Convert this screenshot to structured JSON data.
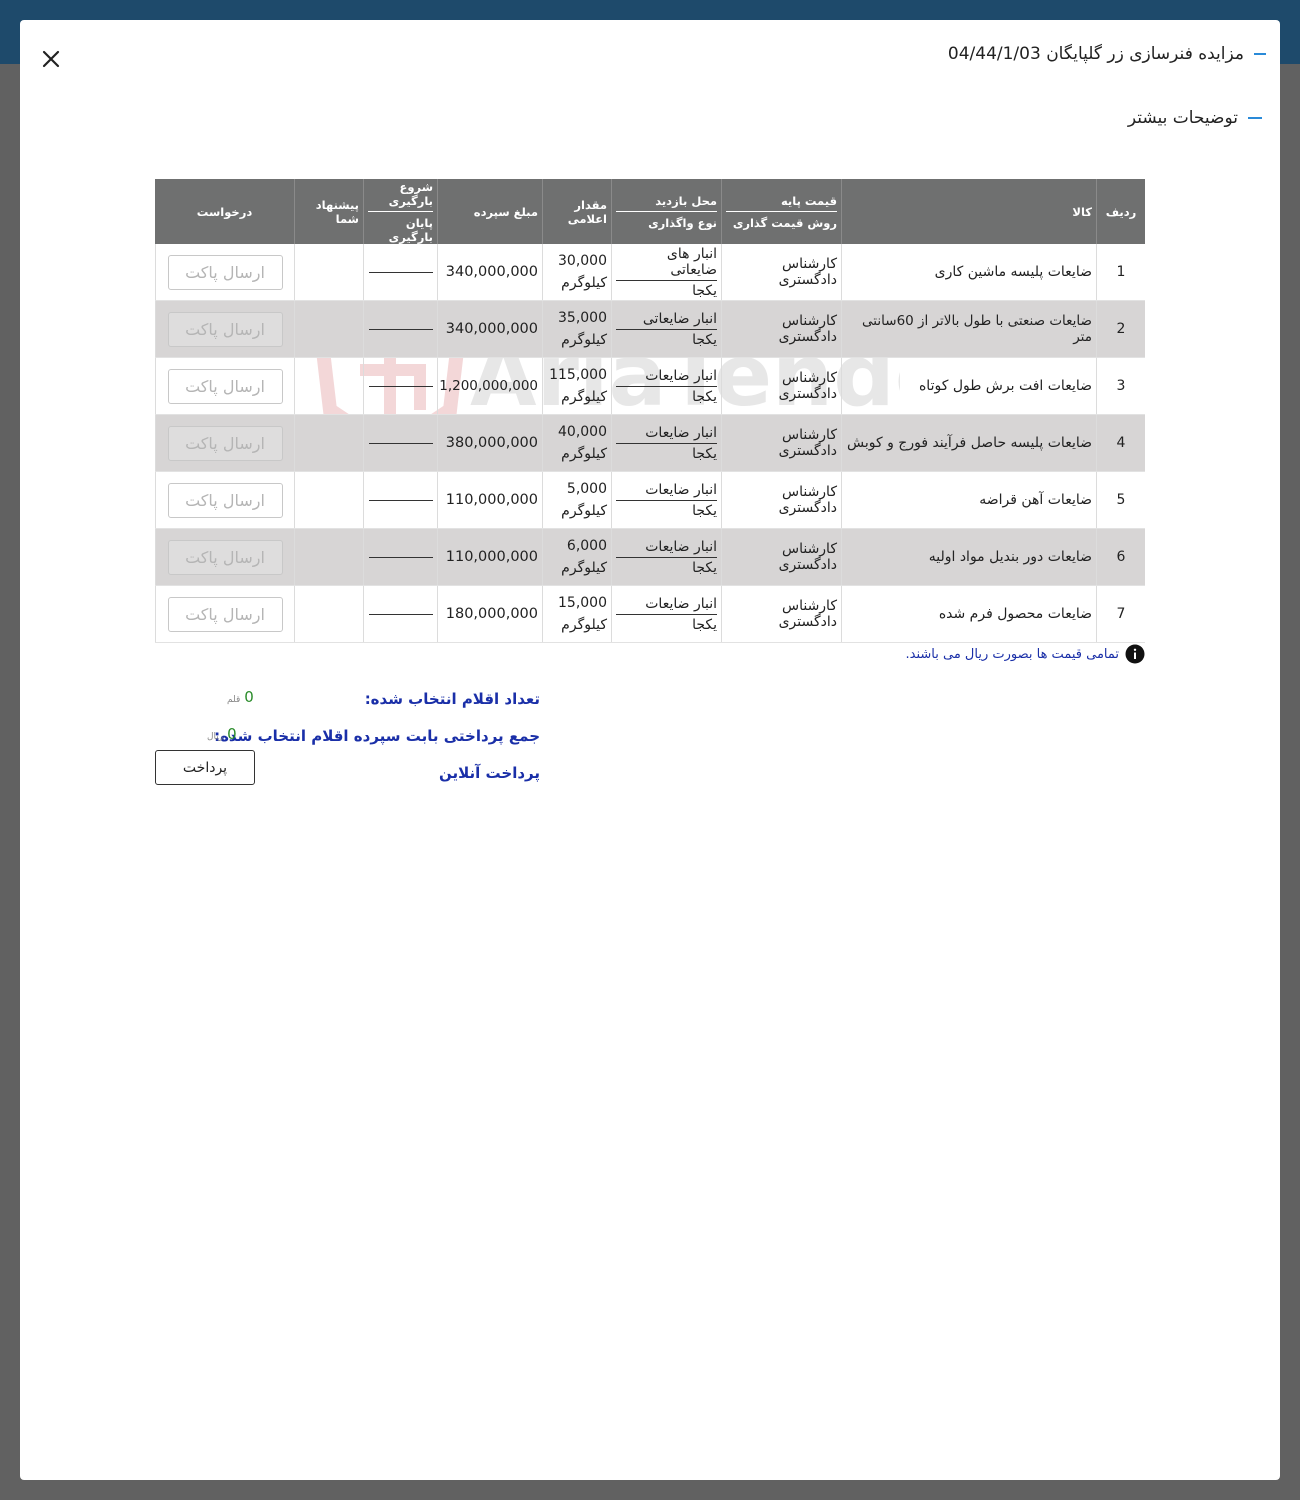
{
  "modal": {
    "title": "مزایده فنرسازی زر گلپایگان 04/44/1/03",
    "subtitle": "توضیحات بیشتر"
  },
  "watermark": "AriaTender.neT",
  "table": {
    "headers": {
      "row_no": "ردیف",
      "item": "کالا",
      "base_price": "قیمت پایه",
      "pricing_method": "روش قیمت گذاری",
      "visit_place": "محل بازدید",
      "assign_type": "نوع واگذاری",
      "quantity": "مقدار اعلامی",
      "deposit": "مبلغ سپرده",
      "load_start": "شروع بارگیری",
      "load_end": "پایان بارگیری",
      "your_offer": "پیشنهاد شما",
      "request": "درخواست"
    },
    "rows": [
      {
        "no": "1",
        "item": "ضایعات پلیسه ماشین کاری",
        "pricing": "کارشناس دادگستری",
        "place": "انبار های ضایعاتی",
        "assign": "یکجا",
        "qty": "30,000",
        "unit": "کیلوگرم",
        "deposit": "340,000,000",
        "action": "ارسال پاکت"
      },
      {
        "no": "2",
        "item": "ضایعات صنعتی با طول بالاتر از 60سانتی متر",
        "pricing": "کارشناس دادگستری",
        "place": "انبار ضایعاتی",
        "assign": "یکجا",
        "qty": "35,000",
        "unit": "کیلوگرم",
        "deposit": "340,000,000",
        "action": "ارسال پاکت"
      },
      {
        "no": "3",
        "item": "ضایعات افت برش طول کوتاه",
        "pricing": "کارشناس دادگستری",
        "place": "انبار ضایعات",
        "assign": "یکجا",
        "qty": "115,000",
        "unit": "کیلوگرم",
        "deposit": "1,200,000,000",
        "action": "ارسال پاکت"
      },
      {
        "no": "4",
        "item": "ضایعات پلیسه حاصل فرآیند فورج و کوبش",
        "pricing": "کارشناس دادگستری",
        "place": "انبار ضایعات",
        "assign": "یکجا",
        "qty": "40,000",
        "unit": "کیلوگرم",
        "deposit": "380,000,000",
        "action": "ارسال پاکت"
      },
      {
        "no": "5",
        "item": "ضایعات آهن قراضه",
        "pricing": "کارشناس دادگستری",
        "place": "انبار ضایعات",
        "assign": "یکجا",
        "qty": "5,000",
        "unit": "کیلوگرم",
        "deposit": "110,000,000",
        "action": "ارسال پاکت"
      },
      {
        "no": "6",
        "item": "ضایعات دور بندیل مواد اولیه",
        "pricing": "کارشناس دادگستری",
        "place": "انبار ضایعات",
        "assign": "یکجا",
        "qty": "6,000",
        "unit": "کیلوگرم",
        "deposit": "110,000,000",
        "action": "ارسال پاکت"
      },
      {
        "no": "7",
        "item": "ضایعات محصول فرم شده",
        "pricing": "کارشناس دادگستری",
        "place": "انبار ضایعات",
        "assign": "یکجا",
        "qty": "15,000",
        "unit": "کیلوگرم",
        "deposit": "180,000,000",
        "action": "ارسال پاکت"
      }
    ]
  },
  "note": "تمامی قیمت ها بصورت ریال می باشند.",
  "summary": {
    "selected_label": "تعداد اقلام انتخاب شده:",
    "selected_value": "0",
    "selected_unit": "قلم",
    "total_label": "جمع پرداختی بابت سپرده اقلام انتخاب شده:",
    "total_value": "0",
    "total_unit": "ریال",
    "online_label": "پرداخت آنلاین",
    "pay_button": "پرداخت"
  },
  "colors": {
    "header_bg": "#6f7070",
    "accent": "#2a8ad8",
    "label_blue": "#1a2fa8",
    "value_green": "#2a8c2a",
    "shade_row": "#d7d5d5",
    "overlay": "#616161"
  }
}
